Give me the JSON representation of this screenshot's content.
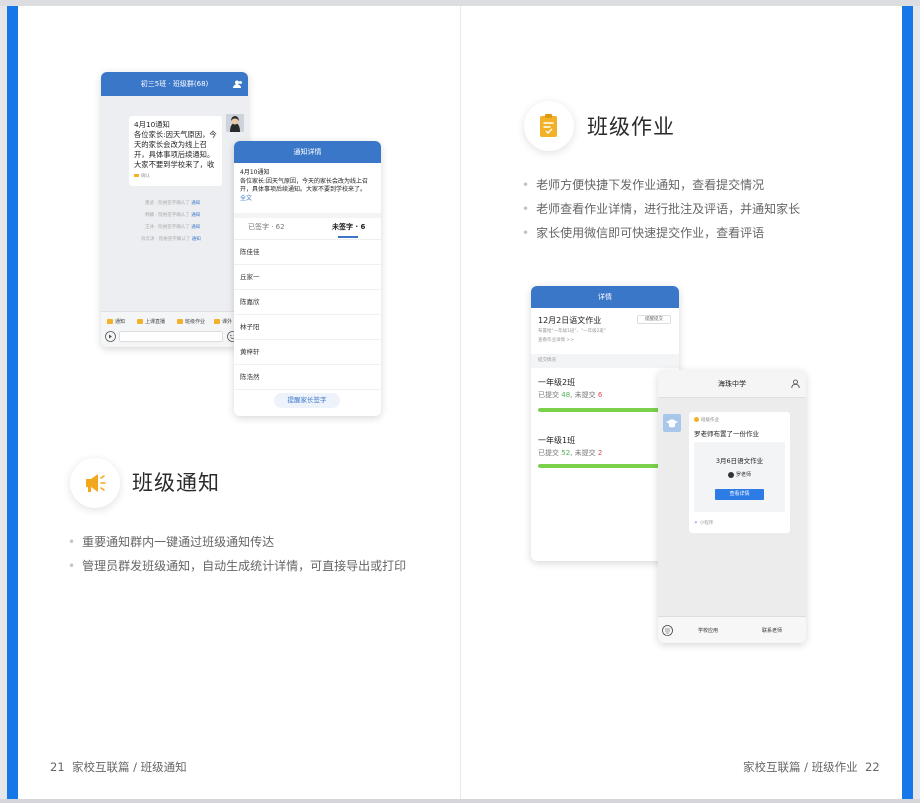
{
  "left_page": {
    "chat_phone": {
      "title": "初三5班 · 班级群(68)",
      "date_line": "4月10通知",
      "message": "各位家长:因天气原因，今天的家长会改为线上召开，具体事项后续通知。大家不要到学校来了，收到的家长麻烦相...",
      "reply_tag": "确认",
      "system_lines": [
        {
          "text": "墨迹 · 阮裕签字确认了",
          "link": "通知"
        },
        {
          "text": "韩橘 · 阮裕签字确认了",
          "link": "通知"
        },
        {
          "text": "王沐 · 阮裕签字确认了",
          "link": "通知"
        },
        {
          "text": "肖云涛 · 阮裕签字确认了",
          "link": "通知"
        }
      ],
      "toolbar": [
        "通知",
        "上课直播",
        "班级作业",
        "课外"
      ]
    },
    "detail_phone": {
      "title": "通知详情",
      "date_line": "4月10通知",
      "body": "各位家长:因天气原因，今天的家长会改为线上召开，具体事项后续通知。大家不要到学校来了。",
      "expand": "全文",
      "tab_signed": "已签字 · 62",
      "tab_unsigned": "未签字 · 6",
      "names": [
        "陈佳佳",
        "丘家一",
        "陈嘉欣",
        "林子阳",
        "黄梓轩",
        "陈浩然"
      ],
      "remind_button": "提醒家长签字"
    },
    "feature": {
      "icon": "megaphone-icon",
      "title": "班级通知",
      "bullets": [
        "重要通知群内一键通过班级通知传达",
        "管理员群发班级通知，自动生成统计详情，可直接导出或打印"
      ]
    },
    "footer": {
      "page_number": "21",
      "section": "家校互联篇 / 班级通知"
    }
  },
  "right_page": {
    "feature": {
      "icon": "homework-icon",
      "title": "班级作业",
      "bullets": [
        "老师方便快捷下发作业通知，查看提交情况",
        "老师查看作业详情，进行批注及评语，并通知家长",
        "家长使用微信即可快速提交作业，查看评语"
      ]
    },
    "detail_phone": {
      "title": "详情",
      "homework_title": "12月2日语文作业",
      "remind": "提醒提交",
      "subtitle": "布置给\"一年级1班\"、\"一年级2班\"",
      "more": "查看作业详情 >>",
      "section": "提交情况",
      "classes": [
        {
          "name": "一年级2班",
          "submitted": "48",
          "unsubmitted": "6",
          "progress": 0.89
        },
        {
          "name": "一年级1班",
          "submitted": "52",
          "unsubmitted": "2",
          "progress": 0.96
        }
      ],
      "submitted_label": "已提交",
      "unsubmitted_label": "未提交"
    },
    "wechat_phone": {
      "title": "海珠中学",
      "card_tag": "班级作业",
      "card_title": "罗老师布置了一份作业",
      "inner_title": "3月6日语文作业",
      "teacher": "罗老师",
      "button": "查看详情",
      "mini_label": "小程序",
      "menu": [
        "学校应用",
        "联系老师"
      ]
    },
    "footer": {
      "section": "家校互联篇 / 班级作业",
      "page_number": "22"
    }
  },
  "colors": {
    "accent": "#1677e8",
    "header_blue": "#3b77c9",
    "icon_yellow": "#f2b127",
    "progress_green": "#7bd14a"
  }
}
